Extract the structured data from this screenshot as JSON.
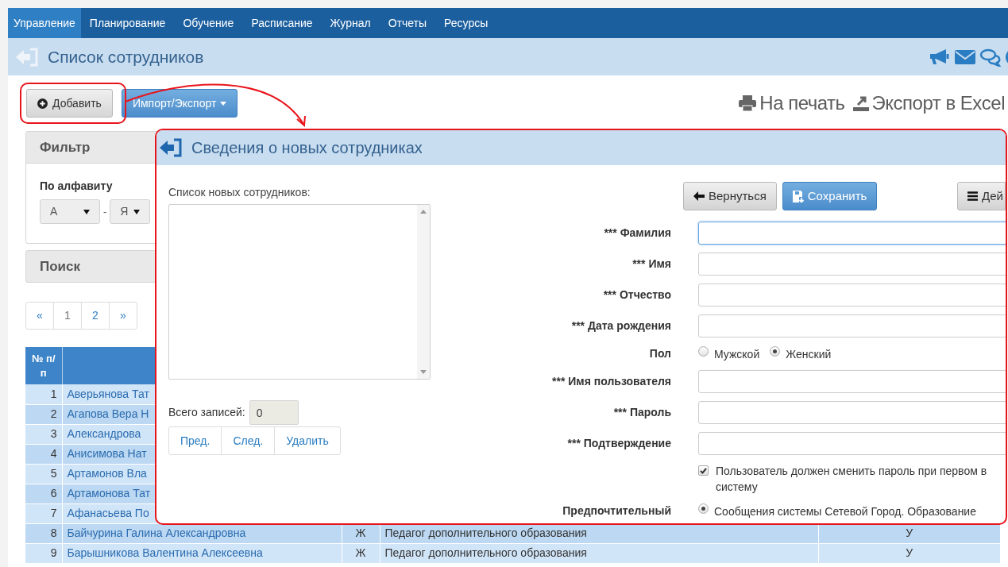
{
  "nav": {
    "items": [
      {
        "label": "Управление",
        "selected": true
      },
      {
        "label": "Планирование",
        "selected": false
      },
      {
        "label": "Обучение",
        "selected": false
      },
      {
        "label": "Расписание",
        "selected": false
      },
      {
        "label": "Журнал",
        "selected": false
      },
      {
        "label": "Отчеты",
        "selected": false
      },
      {
        "label": "Ресурсы",
        "selected": false
      }
    ]
  },
  "page": {
    "title": "Список сотрудников"
  },
  "toolbar": {
    "add": "Добавить",
    "import_export": "Импорт/Экспорт",
    "print": "На печать",
    "export": "Экспорт в Excel"
  },
  "filter": {
    "title": "Фильтр",
    "alphabet_label": "По алфавиту",
    "from": "А",
    "separator": "-",
    "to": "Я"
  },
  "search": {
    "title": "Поиск"
  },
  "pagination": [
    {
      "label": "«",
      "selected": false
    },
    {
      "label": "1",
      "selected": true
    },
    {
      "label": "2",
      "selected": false
    },
    {
      "label": "»",
      "selected": false
    }
  ],
  "table": {
    "columns": [
      "№ п/п"
    ],
    "rows": [
      [
        "1",
        "Аверьянова Тат"
      ],
      [
        "2",
        "Агапова Вера Н"
      ],
      [
        "3",
        "Александрова"
      ],
      [
        "4",
        "Анисимова Нат"
      ],
      [
        "5",
        "Артамонов Вла"
      ],
      [
        "6",
        "Артамонова Тат"
      ],
      [
        "7",
        "Афанасьева По"
      ],
      [
        "8",
        "Байчурина Галина Александровна",
        "Ж",
        "Педагог дополнительного образования",
        "У"
      ],
      [
        "9",
        "Барышникова Валентина Алексеевна",
        "Ж",
        "Педагог дополнительного образования",
        "У"
      ]
    ]
  },
  "dialog": {
    "title": "Сведения о новых сотрудниках",
    "list_label": "Список новых сотрудников:",
    "total_label": "Всего записей:",
    "total_value": "0",
    "list_buttons": [
      "Пред.",
      "След.",
      "Удалить"
    ],
    "actions": [
      {
        "label": "Вернуться",
        "kind": "back"
      },
      {
        "label": "Сохранить",
        "kind": "save"
      },
      {
        "label": "Дей",
        "kind": "menu"
      }
    ],
    "fields": [
      {
        "kind": "text",
        "label": "*** Фамилия",
        "focused": true
      },
      {
        "kind": "text",
        "label": "*** Имя",
        "focused": false
      },
      {
        "kind": "text",
        "label": "*** Отчество",
        "focused": false
      },
      {
        "kind": "text",
        "label": "*** Дата рождения",
        "focused": false
      },
      {
        "kind": "radio",
        "label": "Пол",
        "options": [
          {
            "label": "Мужской",
            "selected": false
          },
          {
            "label": "Женский",
            "selected": true
          }
        ]
      },
      {
        "kind": "text",
        "label": "*** Имя пользователя",
        "focused": false
      },
      {
        "kind": "text",
        "label": "*** Пароль",
        "focused": false
      },
      {
        "kind": "text",
        "label": "*** Подтверждение",
        "focused": false
      },
      {
        "kind": "checkbox",
        "checked": true,
        "lines": [
          "Пользователь должен сменить пароль при первом в",
          "систему"
        ]
      },
      {
        "kind": "radio",
        "label": "Предпочтительный",
        "options": [
          {
            "label": "Сообщения системы Сетевой Город. Образование",
            "selected": true
          }
        ]
      }
    ]
  }
}
